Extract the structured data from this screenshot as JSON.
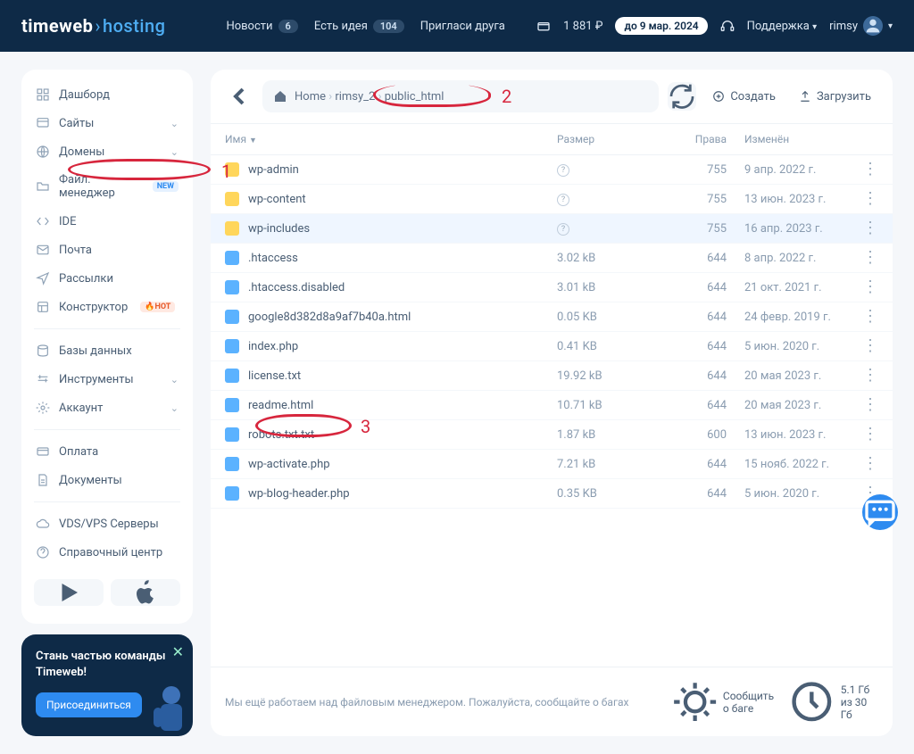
{
  "header": {
    "logo1": "timeweb",
    "logo2": "hosting",
    "nav": [
      {
        "label": "Новости",
        "count": "6"
      },
      {
        "label": "Есть идея",
        "count": "104"
      },
      {
        "label": "Пригласи друга"
      }
    ],
    "balance": "1 881 ₽",
    "until": "до 9 мар. 2024",
    "support": "Поддержка",
    "user": "rimsy"
  },
  "sidebar": {
    "items": [
      {
        "icon": "dashboard",
        "label": "Дашборд"
      },
      {
        "icon": "sites",
        "label": "Сайты",
        "chev": true
      },
      {
        "icon": "globe",
        "label": "Домены",
        "chev": true
      },
      {
        "icon": "folder",
        "label": "Файл. менеджер",
        "tag": "NEW",
        "tagClass": "tag-new"
      },
      {
        "icon": "code",
        "label": "IDE"
      },
      {
        "icon": "mail",
        "label": "Почта"
      },
      {
        "icon": "send",
        "label": "Рассылки"
      },
      {
        "icon": "builder",
        "label": "Конструктор",
        "tag": "🔥HOT",
        "tagClass": "tag-hot"
      }
    ],
    "group2": [
      {
        "icon": "db",
        "label": "Базы данных"
      },
      {
        "icon": "tools",
        "label": "Инструменты",
        "chev": true
      },
      {
        "icon": "gear",
        "label": "Аккаунт",
        "chev": true
      }
    ],
    "group3": [
      {
        "icon": "card",
        "label": "Оплата"
      },
      {
        "icon": "doc",
        "label": "Документы"
      }
    ],
    "group4": [
      {
        "icon": "cloud",
        "label": "VDS/VPS Серверы"
      },
      {
        "icon": "help",
        "label": "Справочный центр"
      }
    ]
  },
  "promo": {
    "title": "Стань частью команды Timeweb!",
    "button": "Присоединиться"
  },
  "filemanager": {
    "crumbs": [
      "Home",
      "rimsy_2",
      "public_html"
    ],
    "create": "Создать",
    "upload": "Загрузить",
    "columns": {
      "name": "Имя",
      "size": "Размер",
      "perm": "Права",
      "date": "Изменён"
    },
    "rows": [
      {
        "t": "folder",
        "name": "wp-admin",
        "size": "?",
        "perm": "755",
        "date": "9 апр. 2022 г."
      },
      {
        "t": "folder",
        "name": "wp-content",
        "size": "?",
        "perm": "755",
        "date": "13 июн. 2023 г."
      },
      {
        "t": "folder",
        "name": "wp-includes",
        "size": "?",
        "perm": "755",
        "date": "16 апр. 2023 г.",
        "hl": true
      },
      {
        "t": "file",
        "name": ".htaccess",
        "size": "3.02 kB",
        "perm": "644",
        "date": "8 апр. 2022 г."
      },
      {
        "t": "file",
        "name": ".htaccess.disabled",
        "size": "3.01 kB",
        "perm": "644",
        "date": "21 окт. 2021 г."
      },
      {
        "t": "file",
        "name": "google8d382d8a9af7b40a.html",
        "size": "0.05 KB",
        "perm": "644",
        "date": "24 февр. 2019 г."
      },
      {
        "t": "file",
        "name": "index.php",
        "size": "0.41 KB",
        "perm": "644",
        "date": "5 июн. 2020 г."
      },
      {
        "t": "file",
        "name": "license.txt",
        "size": "19.92 kB",
        "perm": "644",
        "date": "20 мая 2023 г."
      },
      {
        "t": "file",
        "name": "readme.html",
        "size": "10.71 kB",
        "perm": "644",
        "date": "20 мая 2023 г."
      },
      {
        "t": "file",
        "name": "robots.txt.txt",
        "size": "1.87 kB",
        "perm": "600",
        "date": "13 июн. 2023 г."
      },
      {
        "t": "file",
        "name": "wp-activate.php",
        "size": "7.21 kB",
        "perm": "644",
        "date": "15 нояб. 2022 г."
      },
      {
        "t": "file",
        "name": "wp-blog-header.php",
        "size": "0.35 KB",
        "perm": "644",
        "date": "5 июн. 2020 г."
      }
    ],
    "footer": {
      "msg": "Мы ещё работаем над файловым менеджером. Пожалуйста, сообщайте о багах",
      "report": "Сообщить о баге",
      "quota": "5.1 Гб из 30 Гб"
    }
  },
  "annotations": {
    "a1": "1",
    "a2": "2",
    "a3": "3"
  }
}
